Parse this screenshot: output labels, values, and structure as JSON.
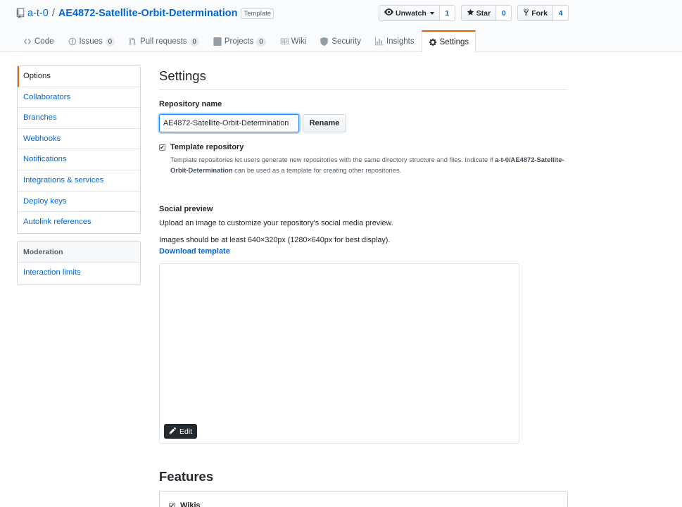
{
  "repo": {
    "owner": "a-t-0",
    "separator": "/",
    "name": "AE4872-Satellite-Orbit-Determination",
    "template_label": "Template"
  },
  "actions": {
    "watch": {
      "label": "Unwatch",
      "count": "1"
    },
    "star": {
      "label": "Star",
      "count": "0"
    },
    "fork": {
      "label": "Fork",
      "count": "4"
    }
  },
  "tabs": [
    {
      "label": "Code",
      "icon": "code-icon"
    },
    {
      "label": "Issues",
      "count": "0",
      "icon": "issue-icon"
    },
    {
      "label": "Pull requests",
      "count": "0",
      "icon": "pull-request-icon"
    },
    {
      "label": "Projects",
      "count": "0",
      "icon": "project-icon"
    },
    {
      "label": "Wiki",
      "icon": "book-icon"
    },
    {
      "label": "Security",
      "icon": "shield-icon"
    },
    {
      "label": "Insights",
      "icon": "graph-icon"
    },
    {
      "label": "Settings",
      "icon": "gear-icon",
      "selected": true
    }
  ],
  "sidebar": {
    "items": [
      {
        "label": "Options"
      },
      {
        "label": "Collaborators"
      },
      {
        "label": "Branches"
      },
      {
        "label": "Webhooks"
      },
      {
        "label": "Notifications"
      },
      {
        "label": "Integrations & services"
      },
      {
        "label": "Deploy keys"
      },
      {
        "label": "Autolink references"
      }
    ],
    "moderation_heading": "Moderation",
    "moderation_items": [
      {
        "label": "Interaction limits"
      }
    ]
  },
  "main": {
    "title": "Settings",
    "repo_name_label": "Repository name",
    "repo_name_value": "AE4872-Satellite-Orbit-Determination",
    "rename_label": "Rename",
    "template_checkbox_label": "Template repository",
    "template_note_pre": "Template repositories let users generate new repositories with the same directory structure and files. Indicate if ",
    "template_note_strong": "a-t-0/AE4872-Satellite-Orbit-Determination",
    "template_note_post": " can be used as a template for creating other repositories.",
    "social_preview_label": "Social preview",
    "social_preview_desc": "Upload an image to customize your repository's social media preview.",
    "social_preview_size": "Images should be at least 640×320px (1280×640px for best display).",
    "download_template": "Download template",
    "edit_label": "Edit",
    "features_title": "Features",
    "features_first_item": "Wikis"
  },
  "colors": {
    "link": "#0366d6",
    "accent": "#e36209",
    "border": "#e1e4e8"
  }
}
